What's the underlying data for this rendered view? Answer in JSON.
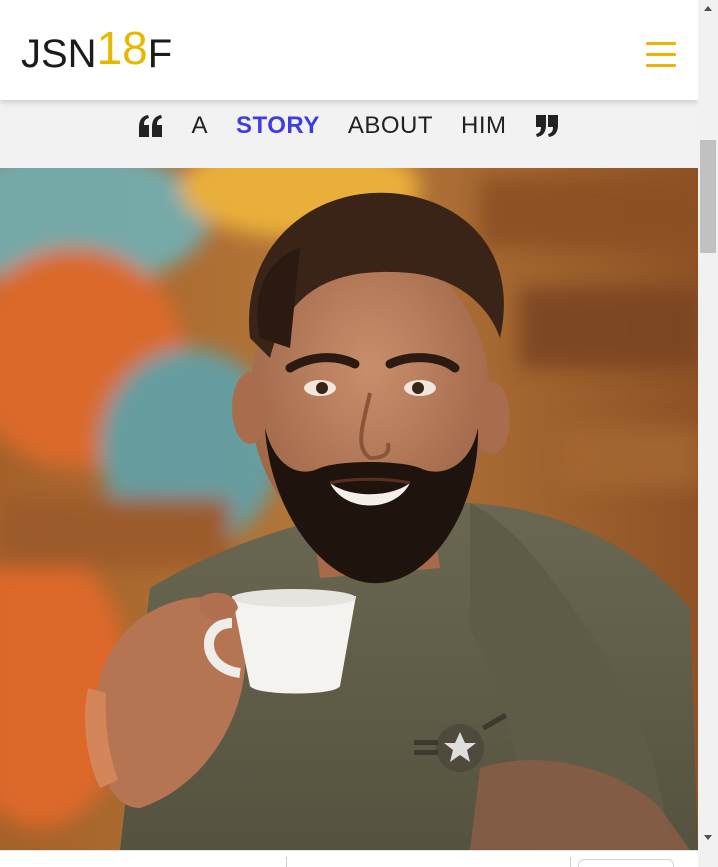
{
  "brand": {
    "logo_left": "JSN",
    "logo_accent": "18",
    "logo_right": "F",
    "accent_color": "#e6b800"
  },
  "header": {
    "menu_icon": "hamburger-icon"
  },
  "heading": {
    "open_quote_icon": "open-quote-icon",
    "words": [
      "A",
      "STORY",
      "ABOUT",
      "HIM"
    ],
    "highlight_color": "#3d3de0",
    "close_quote_icon": "close-quote-icon"
  },
  "hero": {
    "image_icon": "portrait-photo"
  }
}
